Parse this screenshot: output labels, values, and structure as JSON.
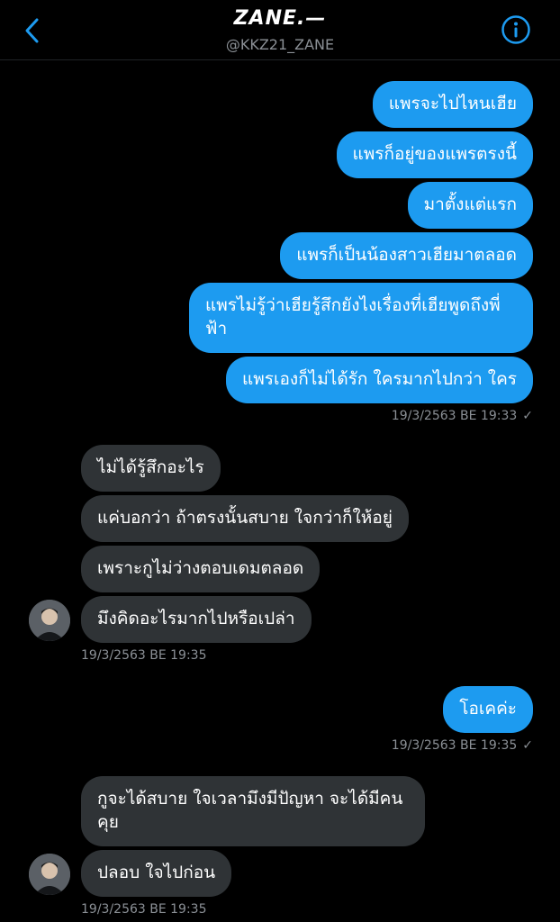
{
  "header": {
    "title": "ZANE.—",
    "handle": "@KKZ21_ZANE"
  },
  "messages": {
    "m1": "แพรจะไปไหนเฮีย",
    "m2": "แพรก็อยู่ของแพรตรงนี้",
    "m3": "มาตั้งแต่แรก",
    "m4": "แพรก็เป็นน้องสาวเฮียมาตลอด",
    "m5": "แพรไม่รู้ว่าเฮียรู้สึกยังไงเรื่องที่เฮียพูดถึงพี่ฟ้า",
    "m6": "แพรเองก็ไม่ได้รัก ใครมากไปกว่า ใคร",
    "m7": "ไม่ได้รู้สึกอะไร",
    "m8": "แค่บอกว่า ถ้าตรงนั้นสบาย ใจกว่าก็ให้อยู่",
    "m9": "เพราะกูไม่ว่างตอบเดมตลอด",
    "m10": "มึงคิดอะไรมากไปหรือเปล่า",
    "m11": "โอเคค่ะ",
    "m12": "กูจะได้สบาย ใจเวลามึงมีปัญหา จะได้มีคนคุย",
    "m13": "ปลอบ ใจไปก่อน"
  },
  "timestamps": {
    "t1": "19/3/2563 BE 19:33",
    "t2": "19/3/2563 BE 19:35",
    "t3": "19/3/2563 BE 19:35",
    "t4": "19/3/2563 BE 19:35"
  },
  "colors": {
    "outgoing": "#1d9bf0",
    "incoming": "#2f3336",
    "background": "#000000"
  }
}
